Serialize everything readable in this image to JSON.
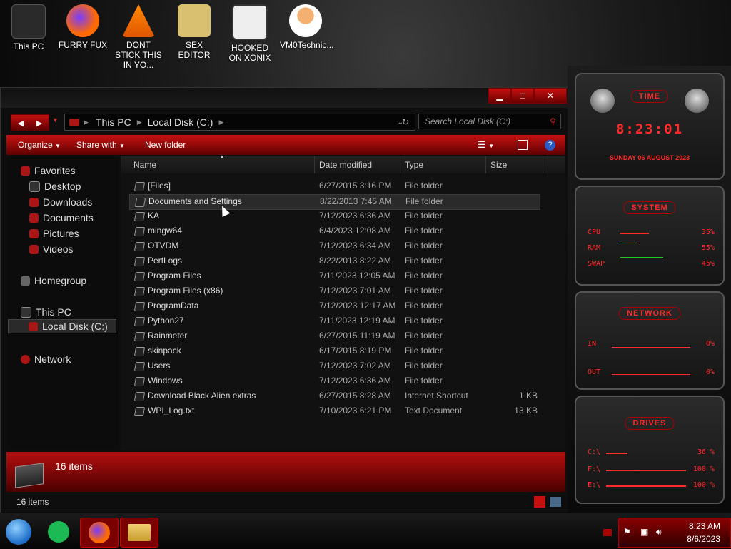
{
  "desktop": {
    "icons": [
      {
        "label": "This PC",
        "color": "#333333"
      },
      {
        "label": "FURRY FUX",
        "color": "#ff6a00"
      },
      {
        "label": "DONT STICK THIS IN YO...",
        "color": "#ff7a00"
      },
      {
        "label": "SEX EDITOR",
        "color": "#c8a040"
      },
      {
        "label": "HOOKED ON XONIX",
        "color": "#e8e8e8"
      },
      {
        "label": "VM0Technic...",
        "color": "#f0a060"
      }
    ]
  },
  "window": {
    "minimize_glyph": "▁",
    "maximize_glyph": "□",
    "close_glyph": "✕",
    "back_glyph": "◀",
    "forward_glyph": "▶",
    "breadcrumb": [
      "This PC",
      "Local Disk (C:)"
    ],
    "search_placeholder": "Search Local Disk (C:)",
    "toolbar": {
      "organize": "Organize",
      "share_with": "Share with",
      "new_folder": "New folder"
    },
    "columns": [
      "Name",
      "Date modified",
      "Type",
      "Size"
    ],
    "nav": {
      "favorites": "Favorites",
      "desktop": "Desktop",
      "downloads": "Downloads",
      "documents": "Documents",
      "pictures": "Pictures",
      "videos": "Videos",
      "homegroup": "Homegroup",
      "this_pc": "This PC",
      "local_disk": "Local Disk (C:)",
      "network": "Network"
    },
    "files": [
      {
        "name": "[Files]",
        "date": "6/27/2015 3:16 PM",
        "type": "File folder",
        "size": ""
      },
      {
        "name": "Documents and Settings",
        "date": "8/22/2013 7:45 AM",
        "type": "File folder",
        "size": ""
      },
      {
        "name": "KA",
        "date": "7/12/2023 6:36 AM",
        "type": "File folder",
        "size": ""
      },
      {
        "name": "mingw64",
        "date": "6/4/2023 12:08 AM",
        "type": "File folder",
        "size": ""
      },
      {
        "name": "OTVDM",
        "date": "7/12/2023 6:34 AM",
        "type": "File folder",
        "size": ""
      },
      {
        "name": "PerfLogs",
        "date": "8/22/2013 8:22 AM",
        "type": "File folder",
        "size": ""
      },
      {
        "name": "Program Files",
        "date": "7/11/2023 12:05 AM",
        "type": "File folder",
        "size": ""
      },
      {
        "name": "Program Files (x86)",
        "date": "7/12/2023 7:01 AM",
        "type": "File folder",
        "size": ""
      },
      {
        "name": "ProgramData",
        "date": "7/12/2023 12:17 AM",
        "type": "File folder",
        "size": ""
      },
      {
        "name": "Python27",
        "date": "7/11/2023 12:19 AM",
        "type": "File folder",
        "size": ""
      },
      {
        "name": "Rainmeter",
        "date": "6/27/2015 11:19 AM",
        "type": "File folder",
        "size": ""
      },
      {
        "name": "skinpack",
        "date": "6/17/2015 8:19 PM",
        "type": "File folder",
        "size": ""
      },
      {
        "name": "Users",
        "date": "7/12/2023 7:02 AM",
        "type": "File folder",
        "size": ""
      },
      {
        "name": "Windows",
        "date": "7/12/2023 6:36 AM",
        "type": "File folder",
        "size": ""
      },
      {
        "name": "Download Black Alien extras",
        "date": "6/27/2015 8:28 AM",
        "type": "Internet Shortcut",
        "size": "1 KB"
      },
      {
        "name": "WPI_Log.txt",
        "date": "7/10/2023 6:21 PM",
        "type": "Text Document",
        "size": "13 KB"
      }
    ],
    "status_count": "16 items",
    "footer_count": "16 items"
  },
  "gadgets": {
    "time_title": "TIME",
    "time": "8:23:01",
    "date": "SUNDAY 06 AUGUST 2023",
    "system_title": "SYSTEM",
    "cpu_label": "CPU",
    "cpu_value": "35%",
    "ram_label": "RAM",
    "ram_value": "55%",
    "swap_label": "SWAP",
    "swap_value": "45%",
    "network_title": "NETWORK",
    "in_label": "IN",
    "in_value": "0%",
    "out_label": "OUT",
    "out_value": "0%",
    "drives_title": "DRIVES",
    "c_label": "C:\\",
    "c_value": "36 %",
    "f_label": "F:\\",
    "f_value": "100 %",
    "e_label": "E:\\",
    "e_value": "100 %"
  },
  "taskbar": {
    "time": "8:23 AM",
    "date": "8/6/2023",
    "accent": "#c41010"
  }
}
